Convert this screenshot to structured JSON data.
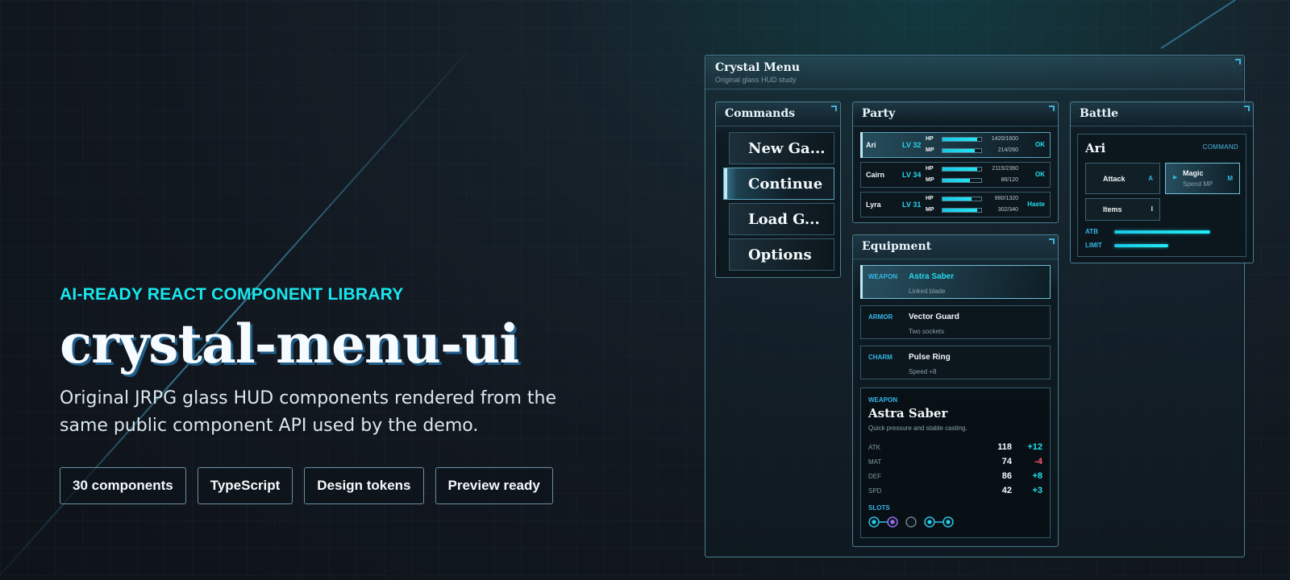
{
  "hero": {
    "eyebrow": "AI-READY REACT COMPONENT LIBRARY",
    "title": "crystal-menu-ui",
    "description": "Original JRPG glass HUD components rendered from the same public component API used by the demo.",
    "chips": [
      "30 components",
      "TypeScript",
      "Design tokens",
      "Preview ready"
    ]
  },
  "menu": {
    "title": "Crystal Menu",
    "subtitle": "Original glass HUD study"
  },
  "commands": {
    "title": "Commands",
    "items": [
      "New Ga...",
      "Continue",
      "Load G...",
      "Options"
    ],
    "active_index": 1
  },
  "party": {
    "title": "Party",
    "members": [
      {
        "name": "Ari",
        "level": "LV 32",
        "hp_label": "HP",
        "mp_label": "MP",
        "hp": "1420/1600",
        "mp": "214/260",
        "hp_ratio": 0.8875,
        "mp_ratio": 0.823,
        "status": "OK",
        "active": true
      },
      {
        "name": "Cairn",
        "level": "LV 34",
        "hp_label": "HP",
        "mp_label": "MP",
        "hp": "2115/2360",
        "mp": "86/120",
        "hp_ratio": 0.896,
        "mp_ratio": 0.717,
        "status": "OK",
        "active": false
      },
      {
        "name": "Lyra",
        "level": "LV 31",
        "hp_label": "HP",
        "mp_label": "MP",
        "hp": "980/1320",
        "mp": "302/340",
        "hp_ratio": 0.742,
        "mp_ratio": 0.888,
        "status": "Haste",
        "active": false
      }
    ]
  },
  "equipment": {
    "title": "Equipment",
    "items": [
      {
        "slot": "WEAPON",
        "name": "Astra Saber",
        "note": "Linked blade",
        "active": true
      },
      {
        "slot": "ARMOR",
        "name": "Vector Guard",
        "note": "Two sockets",
        "active": false
      },
      {
        "slot": "CHARM",
        "name": "Pulse Ring",
        "note": "Speed +8",
        "active": false
      }
    ],
    "detail": {
      "slot": "WEAPON",
      "name": "Astra Saber",
      "description": "Quick pressure and stable casting.",
      "stats": [
        {
          "label": "ATK",
          "value": "118",
          "delta": "+12",
          "positive": true
        },
        {
          "label": "MAT",
          "value": "74",
          "delta": "-4",
          "positive": false
        },
        {
          "label": "DEF",
          "value": "86",
          "delta": "+8",
          "positive": true
        },
        {
          "label": "SPD",
          "value": "42",
          "delta": "+3",
          "positive": true
        }
      ],
      "slots_label": "SLOTS"
    }
  },
  "battle": {
    "title": "Battle",
    "actor": "Ari",
    "mode": "COMMAND",
    "actions": [
      {
        "label": "Attack",
        "key": "A"
      },
      {
        "label": "Magic",
        "sub": "Spend MP",
        "key": "M"
      },
      {
        "label": "Items",
        "key": "I"
      }
    ],
    "gauges": [
      {
        "label": "ATB",
        "ratio": 0.76
      },
      {
        "label": "LIMIT",
        "ratio": 0.43
      }
    ]
  },
  "colors": {
    "accent": "#19e6ee",
    "negative": "#ff5a6e",
    "positive": "#1fe3ee",
    "border": "#4a7d91"
  }
}
